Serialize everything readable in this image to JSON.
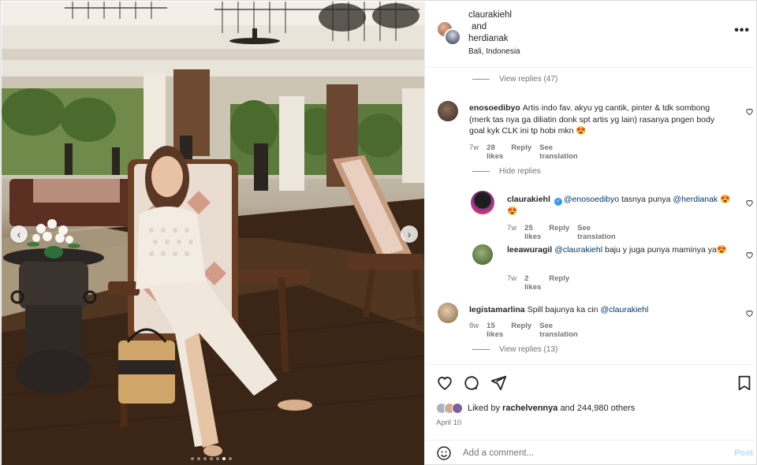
{
  "header": {
    "user1": "claurakiehl",
    "and": "and",
    "user2": "herdianak",
    "location": "Bali, Indonesia",
    "more_icon": "more-horizontal-icon"
  },
  "photo": {
    "prev_arrow": "‹",
    "next_arrow": "›",
    "slide_count": 7,
    "active_slide": 6
  },
  "comments": {
    "view_replies_top": "View replies (47)",
    "c1": {
      "user": "enosoedibyo",
      "text": "Artis indo fav. akyu yg cantik, pinter & tdk sombong (merk tas nya ga diliatin donk spt artis yg lain) rasanya pngen body goal kyk CLK ini tp hobi mkn 😍",
      "time": "7w",
      "likes": "28 likes",
      "reply": "Reply",
      "translate": "See translation"
    },
    "hide_replies": "Hide replies",
    "r1": {
      "user": "claurakiehl",
      "mention": "@enosoedibyo",
      "text": "tasnya punya",
      "mention2": "@herdianak",
      "emoji": "😍😍",
      "time": "7w",
      "likes": "25 likes",
      "reply": "Reply",
      "translate": "See translation"
    },
    "r2": {
      "user": "leeawuragil",
      "mention": "@claurakiehl",
      "text": "baju y juga punya maminya ya😍",
      "time": "7w",
      "likes": "2 likes",
      "reply": "Reply"
    },
    "c2": {
      "user": "legistamarlina",
      "text": "Spill bajunya ka cin",
      "mention": "@claurakiehl",
      "time": "8w",
      "likes": "15 likes",
      "reply": "Reply",
      "translate": "See translation"
    },
    "view_replies_bottom": "View replies (13)"
  },
  "actions": {
    "liked_by": "Liked by",
    "liker": "rachelvennya",
    "and_others": "and 244,980 others",
    "date": "April 10"
  },
  "add_comment": {
    "placeholder": "Add a comment...",
    "post": "Post"
  },
  "colors": {
    "link": "#00376b",
    "muted": "#737373",
    "verified": "#3897f0",
    "post_disabled": "#b2dffc"
  }
}
